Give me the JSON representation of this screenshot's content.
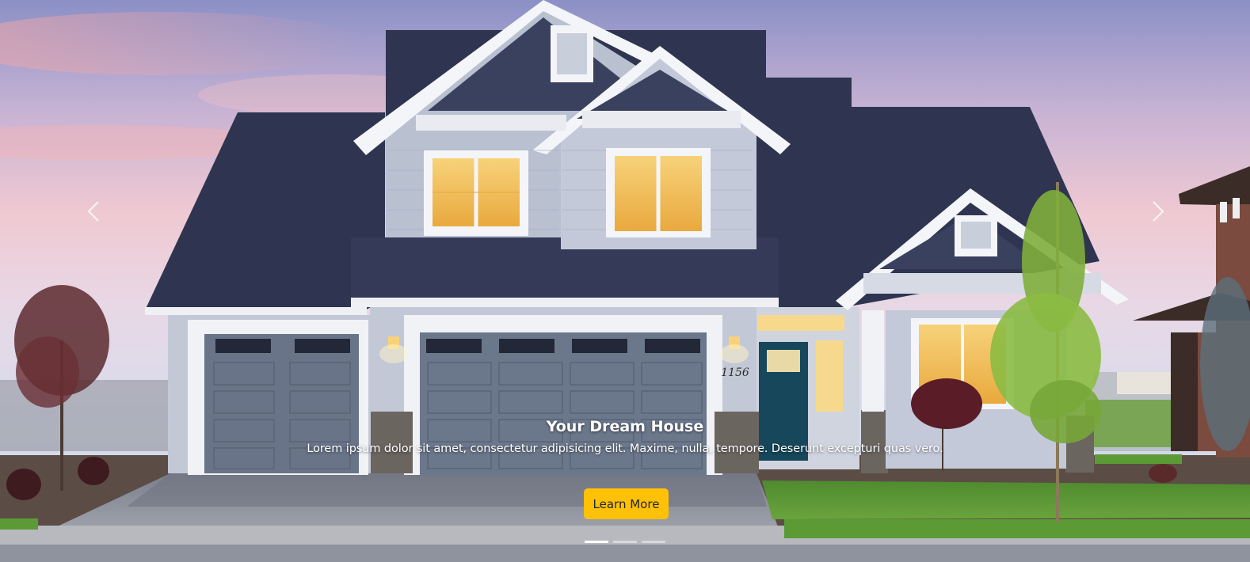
{
  "carousel": {
    "slide": {
      "title": "Your Dream House",
      "text": "Lorem ipsum dolor sit amet, consectetur adipisicing elit. Maxime, nulla, tempore. Deserunt excepturi quas vero.",
      "button_label": "Learn More",
      "house_number": "1156"
    },
    "controls": {
      "prev_icon": "chevron-left-icon",
      "next_icon": "chevron-right-icon"
    },
    "indicators": {
      "count": 3,
      "active_index": 0
    }
  },
  "colors": {
    "button": "#ffc107",
    "roof": "#2f3550",
    "siding": "#c2c8d6",
    "garage_door": "#697488",
    "front_door": "#16475a",
    "window_light": "#f5c060"
  }
}
